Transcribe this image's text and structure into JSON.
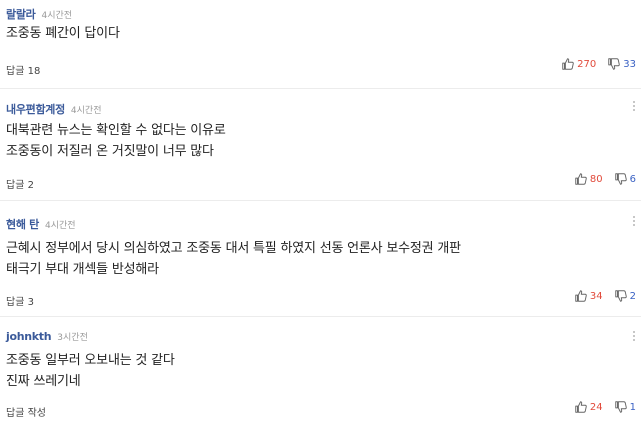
{
  "comments": [
    {
      "author": "랄랄라",
      "time": "4시간전",
      "lines": [
        "조중동 폐간이 답이다"
      ],
      "reply_label": "답글 18",
      "likes": "270",
      "dislikes": "33"
    },
    {
      "author": "내우편함계정",
      "time": "4시간전",
      "lines": [
        "대북관련 뉴스는 확인할 수 없다는 이유로",
        "조중동이 저질러 온 거짓말이 너무 많다"
      ],
      "reply_label": "답글 2",
      "likes": "80",
      "dislikes": "6"
    },
    {
      "author": "현해 탄",
      "time": "4시간전",
      "lines": [
        "근혜시 정부에서 당시 의심하였고 조중동 대서 특필 하였지 선동 언론사 보수정권 개판",
        "태극기 부대 개섹들 반성해라"
      ],
      "reply_label": "답글 3",
      "likes": "34",
      "dislikes": "2"
    },
    {
      "author": "johnkth",
      "time": "3시간전",
      "lines": [
        "조중동 일부러 오보내는 것 같다",
        "진짜 쓰레기네"
      ],
      "reply_label": "답글 작성",
      "likes": "24",
      "dislikes": "1"
    }
  ],
  "colors": {
    "author": "#3b5a9a",
    "like": "#e14a3b",
    "dislike": "#3b62c4",
    "divider": "#ececec"
  },
  "icons": {
    "like": "thumbs-up-icon",
    "dislike": "thumbs-down-icon",
    "more": "more-vertical-icon"
  }
}
